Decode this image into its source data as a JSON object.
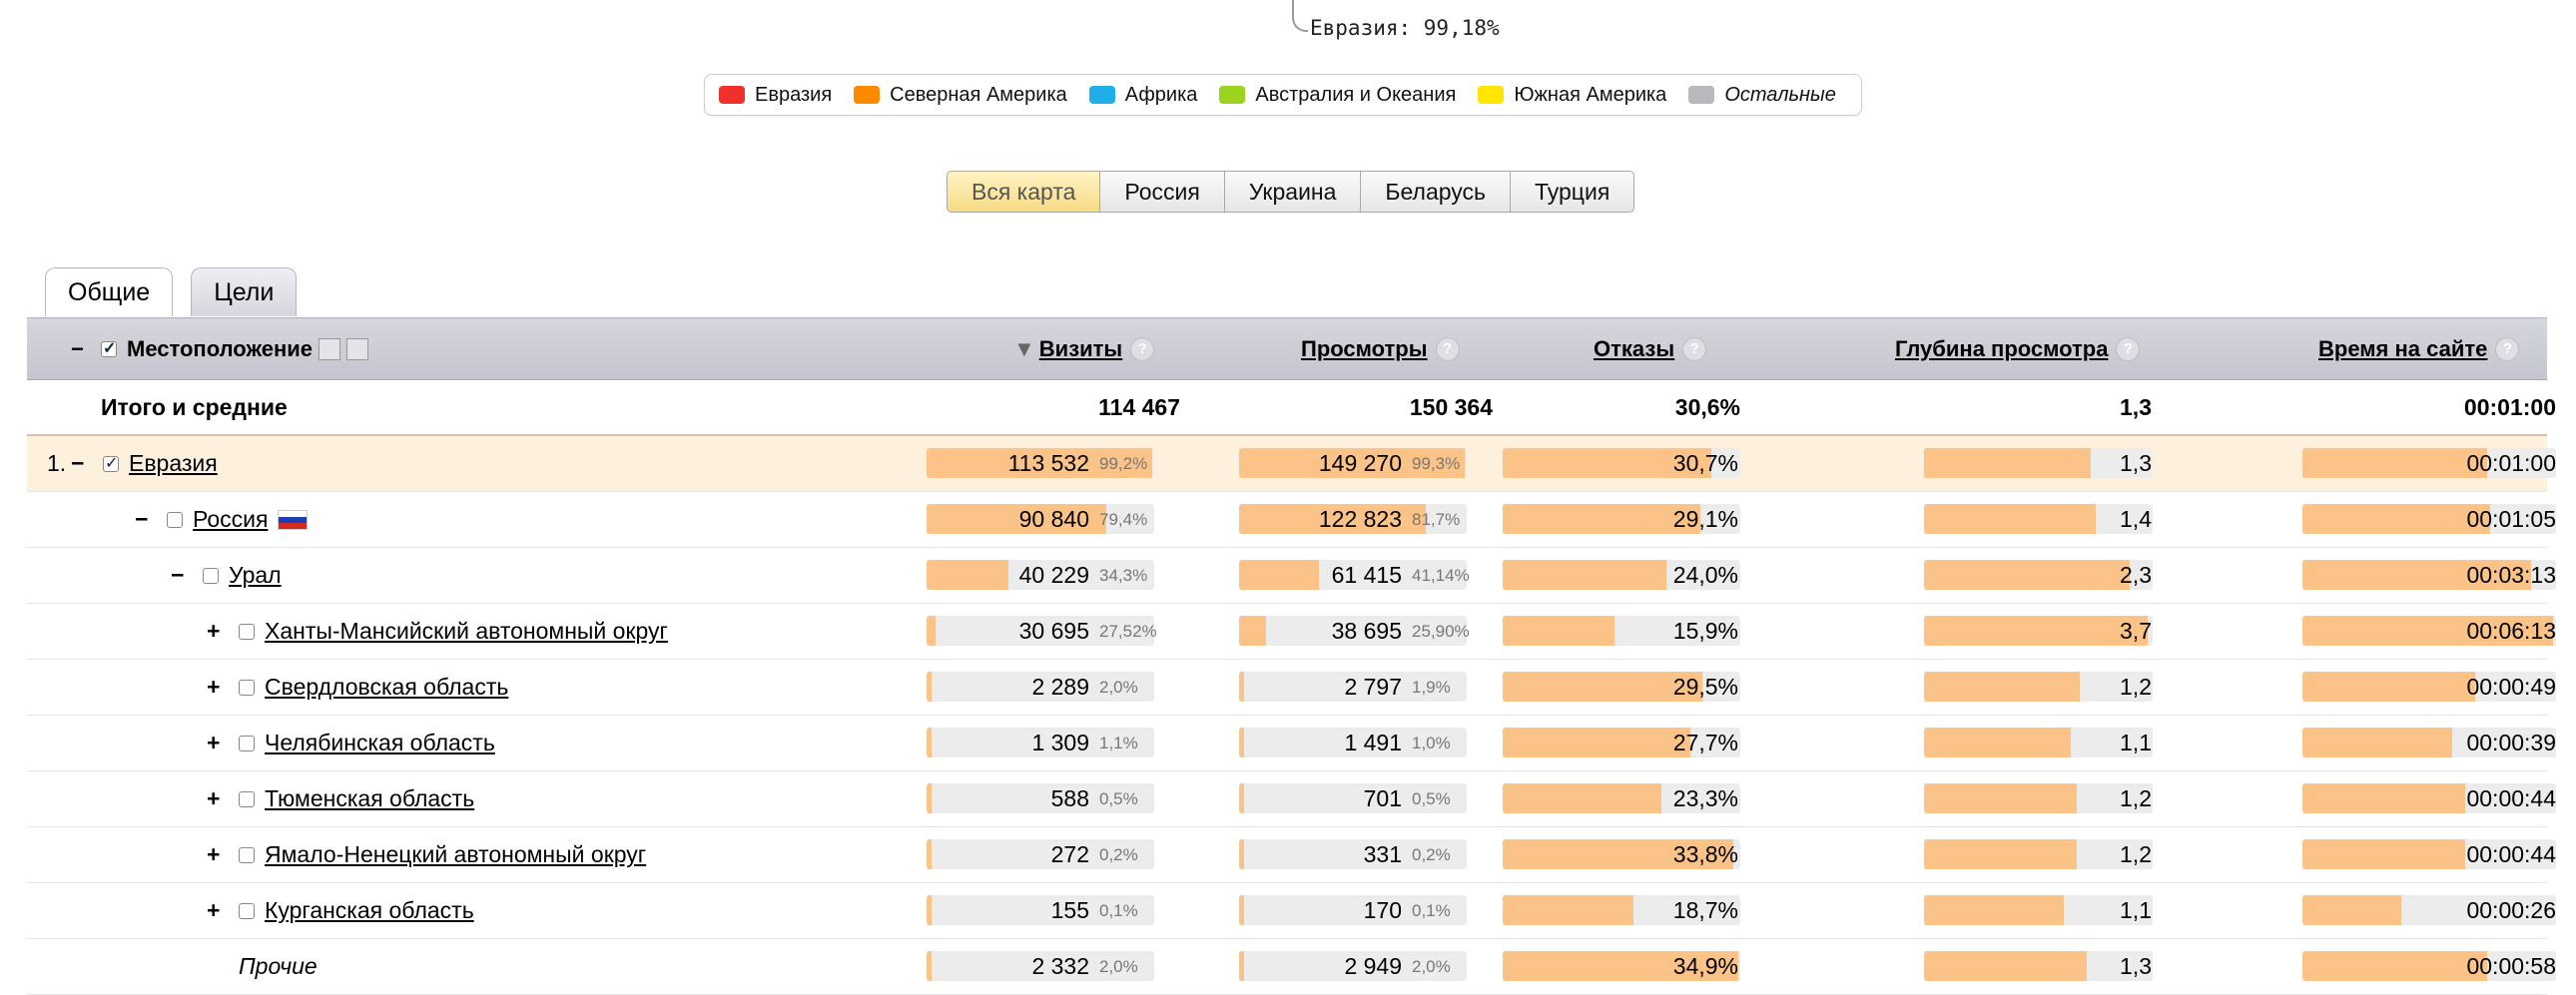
{
  "annotation": "Евразия: 99,18%",
  "legend": [
    {
      "label": "Евразия",
      "color": "#f0302a"
    },
    {
      "label": "Северная Америка",
      "color": "#ff8a00"
    },
    {
      "label": "Африка",
      "color": "#1eaee9"
    },
    {
      "label": "Австралия и Океания",
      "color": "#9bd31e"
    },
    {
      "label": "Южная Америка",
      "color": "#ffe600"
    },
    {
      "label": "Остальные",
      "color": "#b8b8bd"
    }
  ],
  "map_tabs": [
    "Вся карта",
    "Россия",
    "Украина",
    "Беларусь",
    "Турция"
  ],
  "tabs": [
    "Общие",
    "Цели"
  ],
  "columns": {
    "location": "Местоположение",
    "visits": "Визиты",
    "views": "Просмотры",
    "bounces": "Отказы",
    "depth": "Глубина просмотра",
    "time": "Время на сайте",
    "sort_indicator": "▼",
    "help": "?"
  },
  "total": {
    "label": "Итого и средние",
    "visits": "114 467",
    "views": "150 364",
    "bounces": "30,6%",
    "depth": "1,3",
    "time": "00:01:00"
  },
  "rows": [
    {
      "num": "1.",
      "toggle": "−",
      "label": "Евразия",
      "visits": "113 532",
      "vpct": "99,2%",
      "views": "149 270",
      "wpct": "99,3%",
      "bounces": "30,7%",
      "depth": "1,3",
      "time": "00:01:00",
      "vis_fill": 0.99,
      "views_fill": 0.99,
      "bounce_fill": 0.88,
      "depth_fill": 0.73,
      "time_fill": 0.73
    },
    {
      "num": "",
      "toggle": "−",
      "label": "Россия",
      "visits": "90 840",
      "vpct": "79,4%",
      "views": "122 823",
      "wpct": "81,7%",
      "bounces": "29,1%",
      "depth": "1,4",
      "time": "00:01:05",
      "vis_fill": 0.79,
      "views_fill": 0.82,
      "bounce_fill": 0.83,
      "depth_fill": 0.75,
      "time_fill": 0.74
    },
    {
      "num": "",
      "toggle": "−",
      "label": "Урал",
      "visits": "40 229",
      "vpct": "34,3%",
      "views": "61 415",
      "wpct": "41,14%",
      "bounces": "24,0%",
      "depth": "2,3",
      "time": "00:03:13",
      "vis_fill": 0.36,
      "views_fill": 0.35,
      "bounce_fill": 0.69,
      "depth_fill": 0.9,
      "time_fill": 0.9
    },
    {
      "num": "",
      "toggle": "+",
      "label": "Ханты-Мансийский автономный округ",
      "visits": "30 695",
      "vpct": "27,52%",
      "views": "38 695",
      "wpct": "25,90%",
      "bounces": "15,9%",
      "depth": "3,7",
      "time": "00:06:13",
      "vis_fill": 0.04,
      "views_fill": 0.12,
      "bounce_fill": 0.47,
      "depth_fill": 0.98,
      "time_fill": 0.99
    },
    {
      "num": "",
      "toggle": "+",
      "label": "Свердловская область",
      "visits": "2 289",
      "vpct": "2,0%",
      "views": "2 797",
      "wpct": "1,9%",
      "bounces": "29,5%",
      "depth": "1,2",
      "time": "00:00:49",
      "vis_fill": 0.02,
      "views_fill": 0.02,
      "bounce_fill": 0.84,
      "depth_fill": 0.68,
      "time_fill": 0.68
    },
    {
      "num": "",
      "toggle": "+",
      "label": "Челябинская область",
      "visits": "1 309",
      "vpct": "1,1%",
      "views": "1 491",
      "wpct": "1,0%",
      "bounces": "27,7%",
      "depth": "1,1",
      "time": "00:00:39",
      "vis_fill": 0.02,
      "views_fill": 0.02,
      "bounce_fill": 0.79,
      "depth_fill": 0.64,
      "time_fill": 0.59
    },
    {
      "num": "",
      "toggle": "+",
      "label": "Тюменская область",
      "visits": "588",
      "vpct": "0,5%",
      "views": "701",
      "wpct": "0,5%",
      "bounces": "23,3%",
      "depth": "1,2",
      "time": "00:00:44",
      "vis_fill": 0.02,
      "views_fill": 0.02,
      "bounce_fill": 0.67,
      "depth_fill": 0.67,
      "time_fill": 0.64
    },
    {
      "num": "",
      "toggle": "+",
      "label": "Ямало-Ненецкий автономный округ",
      "visits": "272",
      "vpct": "0,2%",
      "views": "331",
      "wpct": "0,2%",
      "bounces": "33,8%",
      "depth": "1,2",
      "time": "00:00:44",
      "vis_fill": 0.02,
      "views_fill": 0.02,
      "bounce_fill": 0.97,
      "depth_fill": 0.67,
      "time_fill": 0.64
    },
    {
      "num": "",
      "toggle": "+",
      "label": "Курганская область",
      "visits": "155",
      "vpct": "0,1%",
      "views": "170",
      "wpct": "0,1%",
      "bounces": "18,7%",
      "depth": "1,1",
      "time": "00:00:26",
      "vis_fill": 0.02,
      "views_fill": 0.02,
      "bounce_fill": 0.55,
      "depth_fill": 0.61,
      "time_fill": 0.39
    },
    {
      "num": "",
      "toggle": "",
      "label": "Прочие",
      "visits": "2 332",
      "vpct": "2,0%",
      "views": "2 949",
      "wpct": "2,0%",
      "bounces": "34,9%",
      "depth": "1,3",
      "time": "00:00:58",
      "vis_fill": 0.02,
      "views_fill": 0.02,
      "bounce_fill": 0.99,
      "depth_fill": 0.71,
      "time_fill": 0.73
    }
  ]
}
